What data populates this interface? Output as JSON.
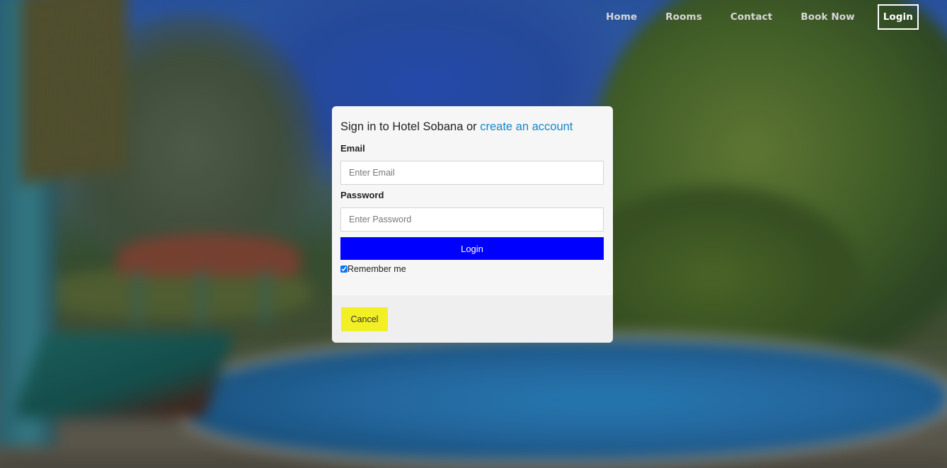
{
  "nav": {
    "items": [
      {
        "label": "Home"
      },
      {
        "label": "Rooms"
      },
      {
        "label": "Contact"
      },
      {
        "label": "Book Now"
      }
    ],
    "login_label": "Login"
  },
  "modal": {
    "title_prefix": "Sign in to Hotel Sobana or ",
    "title_link": "create an account",
    "email_label": "Email",
    "email_placeholder": "Enter Email",
    "password_label": "Password",
    "password_placeholder": "Enter Password",
    "login_button": "Login",
    "remember_label": "Remember me",
    "remember_checked": true,
    "cancel_button": "Cancel"
  },
  "colors": {
    "login_button_bg": "#0000ff",
    "cancel_button_bg": "#f2ef24",
    "link_color": "#1787c7"
  }
}
